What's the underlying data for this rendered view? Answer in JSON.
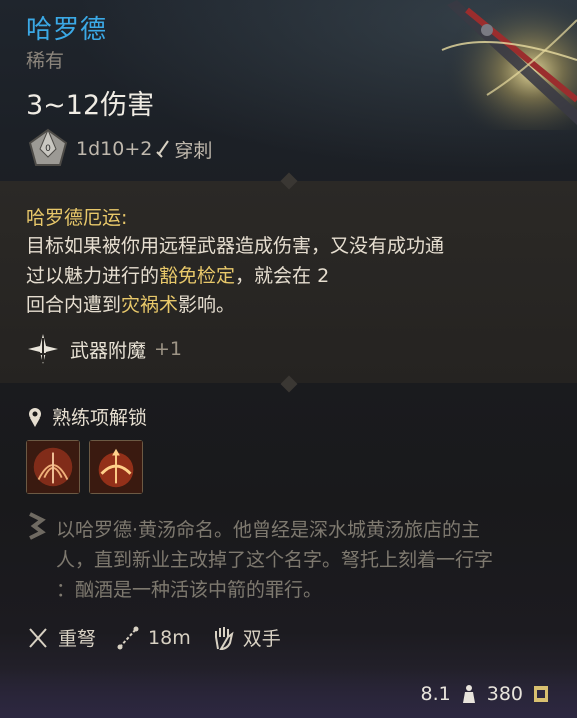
{
  "item": {
    "name": "哈罗德",
    "rarity": "稀有",
    "damage": "3~12伤害",
    "dice": "1d10+2",
    "damage_type": "穿刺"
  },
  "passive": {
    "title": "哈罗德厄运:",
    "desc_1": "目标如果被你用远程武器造成伤害，又没有成功通",
    "desc_2a": "过以魅力进行的",
    "desc_2b": "豁免检定",
    "desc_2c": "，就会在 2",
    "desc_3a": "回合内遭到",
    "desc_3b": "灾祸术",
    "desc_3c": "影响。"
  },
  "enchantment": {
    "label": "武器附魔",
    "value": "+1"
  },
  "proficiency": {
    "label": "熟练项解锁"
  },
  "actions": [
    {
      "name": "action-1"
    },
    {
      "name": "action-2"
    }
  ],
  "lore": {
    "line1": "以哈罗德·黄汤命名。他曾经是深水城黄汤旅店的主",
    "line2": "人，直到新业主改掉了这个名字。弩托上刻着一行字",
    "line3": "：酗酒是一种活该中箭的罪行。"
  },
  "properties": {
    "type": "重弩",
    "range": "18m",
    "hands": "双手"
  },
  "footer": {
    "weight": "8.1",
    "value": "380"
  },
  "colors": {
    "title": "#3ba9e6",
    "keyword": "#e8c86a",
    "lore": "#7e796f"
  }
}
